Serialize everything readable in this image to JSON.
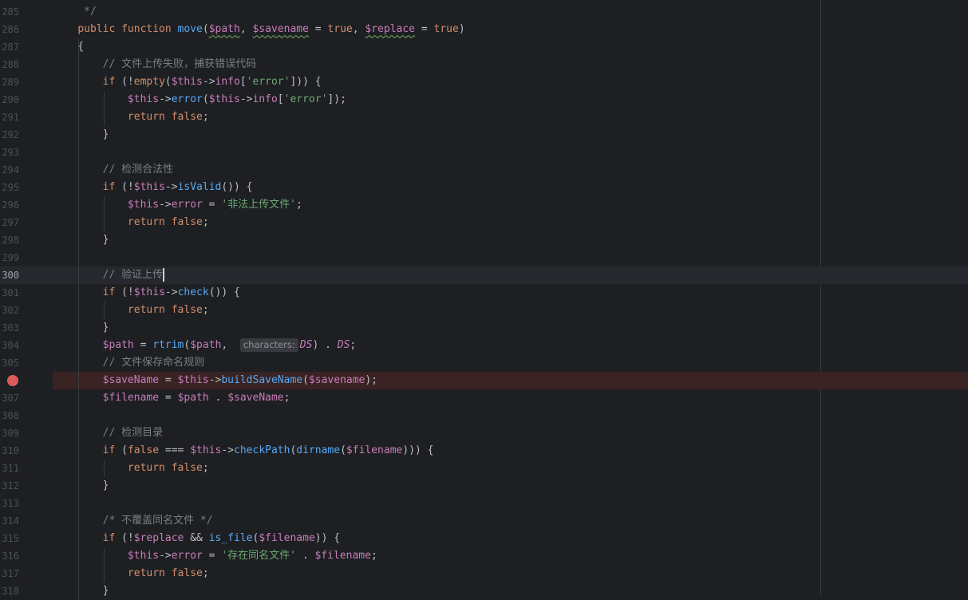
{
  "editor": {
    "current_line": 300,
    "breakpoint_line": 306,
    "lines": [
      {
        "n": "285",
        "html": "<span class=\"t-cm\">     */</span>"
      },
      {
        "n": "286",
        "html": "    <span class=\"t-kw\">public function </span><span class=\"t-fn\">move</span>(<span class=\"t-var t-warn\">$path</span>, <span class=\"t-var t-warn\">$savename</span> = <span class=\"t-kw\">true</span>, <span class=\"t-var t-warn\">$replace</span> = <span class=\"t-kw\">true</span>)"
      },
      {
        "n": "287",
        "html": "    {"
      },
      {
        "n": "288",
        "html": "<span class=\"t-cm\">        // 文件上传失败，捕获错误代码</span>"
      },
      {
        "n": "289",
        "html": "        <span class=\"t-kw\">if</span> (!<span class=\"t-kw\">empty</span>(<span class=\"t-var\">$this</span>-><span class=\"t-var\">info</span>[<span class=\"t-str\">'error'</span>])) {"
      },
      {
        "n": "290",
        "html": "            <span class=\"t-var\">$this</span>-><span class=\"t-fn\">error</span>(<span class=\"t-var\">$this</span>-><span class=\"t-var\">info</span>[<span class=\"t-str\">'error'</span>]);"
      },
      {
        "n": "291",
        "html": "            <span class=\"t-kw\">return false</span>;"
      },
      {
        "n": "292",
        "html": "        }"
      },
      {
        "n": "293",
        "html": ""
      },
      {
        "n": "294",
        "html": "<span class=\"t-cm\">        // 检测合法性</span>"
      },
      {
        "n": "295",
        "html": "        <span class=\"t-kw\">if</span> (!<span class=\"t-var\">$this</span>-><span class=\"t-fn\">isValid</span>()) {"
      },
      {
        "n": "296",
        "html": "            <span class=\"t-var\">$this</span>-><span class=\"t-var\">error</span> = <span class=\"t-str\">'非法上传文件'</span>;"
      },
      {
        "n": "297",
        "html": "            <span class=\"t-kw\">return false</span>;"
      },
      {
        "n": "298",
        "html": "        }"
      },
      {
        "n": "299",
        "html": ""
      },
      {
        "n": "300",
        "html": "<span class=\"t-cm\">        // 验证上传</span><span class=\"caret\"></span>"
      },
      {
        "n": "301",
        "html": "        <span class=\"t-kw\">if</span> (!<span class=\"t-var\">$this</span>-><span class=\"t-fn\">check</span>()) {"
      },
      {
        "n": "302",
        "html": "            <span class=\"t-kw\">return false</span>;"
      },
      {
        "n": "303",
        "html": "        }"
      },
      {
        "n": "304",
        "html": "        <span class=\"t-var\">$path</span> = <span class=\"t-fn\">rtrim</span>(<span class=\"t-var\">$path</span>,  <span class=\"inlay\">characters:</span><span class=\"t-const\">DS</span>) . <span class=\"t-const\">DS</span>;"
      },
      {
        "n": "305",
        "html": "<span class=\"t-cm\">        // 文件保存命名规则</span>"
      },
      {
        "n": "306",
        "html": "        <span class=\"t-var\">$saveName</span> = <span class=\"t-var\">$this</span>-><span class=\"t-fn\">buildSaveName</span>(<span class=\"t-var\">$savename</span>);"
      },
      {
        "n": "307",
        "html": "        <span class=\"t-var\">$filename</span> = <span class=\"t-var\">$path</span> . <span class=\"t-var\">$saveName</span>;"
      },
      {
        "n": "308",
        "html": ""
      },
      {
        "n": "309",
        "html": "<span class=\"t-cm\">        // 检测目录</span>"
      },
      {
        "n": "310",
        "html": "        <span class=\"t-kw\">if</span> (<span class=\"t-kw\">false</span> === <span class=\"t-var\">$this</span>-><span class=\"t-fn\">checkPath</span>(<span class=\"t-fn\">dirname</span>(<span class=\"t-var\">$filename</span>))) {"
      },
      {
        "n": "311",
        "html": "            <span class=\"t-kw\">return false</span>;"
      },
      {
        "n": "312",
        "html": "        }"
      },
      {
        "n": "313",
        "html": ""
      },
      {
        "n": "314",
        "html": "<span class=\"t-cm\">        /* 不覆盖同名文件 */</span>"
      },
      {
        "n": "315",
        "html": "        <span class=\"t-kw\">if</span> (!<span class=\"t-var\">$replace</span> && <span class=\"t-fn\">is_file</span>(<span class=\"t-var\">$filename</span>)) {"
      },
      {
        "n": "316",
        "html": "            <span class=\"t-var\">$this</span>-><span class=\"t-var\">error</span> = <span class=\"t-str\">'存在同名文件'</span> . <span class=\"t-var\">$filename</span>;"
      },
      {
        "n": "317",
        "html": "            <span class=\"t-kw\">return false</span>;"
      },
      {
        "n": "318",
        "html": "        }"
      }
    ]
  },
  "colors": {
    "background": "#1e1f22",
    "keyword": "#cf8e6d",
    "variable": "#c77dbb",
    "function": "#56a8f5",
    "string": "#6aab73",
    "comment": "#7a7e85",
    "breakpoint": "#db5c5c"
  }
}
